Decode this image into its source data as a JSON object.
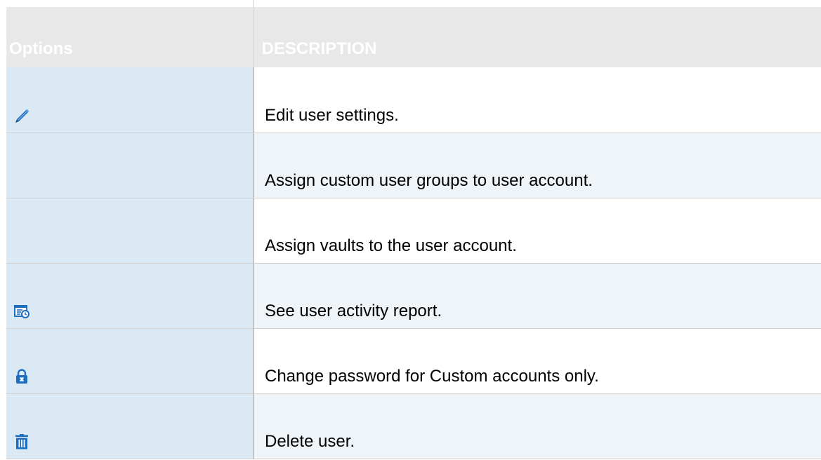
{
  "table": {
    "headers": {
      "options": "Options",
      "description": "DESCRIPTION"
    },
    "rows": [
      {
        "icon": "pencil-icon",
        "description": "Edit user settings."
      },
      {
        "icon": "",
        "description": "Assign custom user groups to user account."
      },
      {
        "icon": "",
        "description": "Assign vaults to the user account."
      },
      {
        "icon": "activity-report-icon",
        "description": "See user activity report."
      },
      {
        "icon": "lock-icon",
        "description": "Change password for Custom accounts only."
      },
      {
        "icon": "trash-icon",
        "description": "Delete user."
      }
    ]
  },
  "colors": {
    "header_background": "#e8e8e8",
    "header_text": "#ffffff",
    "options_column_background": "#dbe9f5",
    "row_tint": "#eff4f9",
    "icon_blue": "#1f6fc0"
  }
}
